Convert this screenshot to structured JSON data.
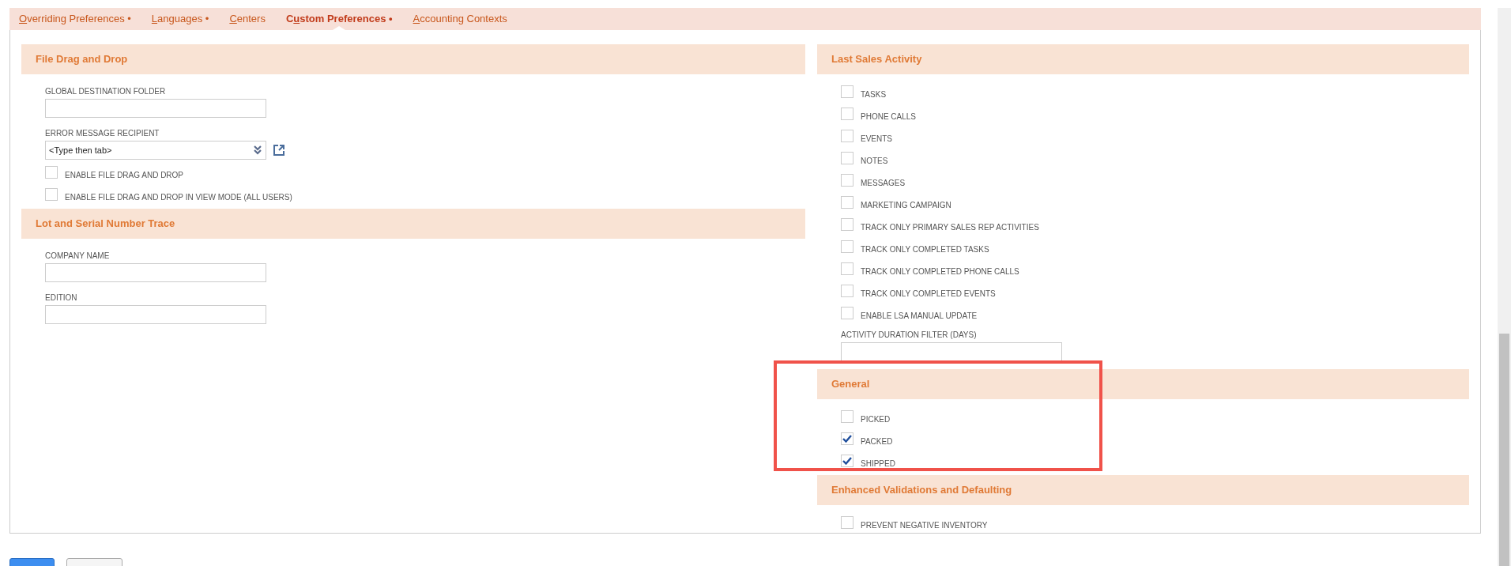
{
  "tabs": [
    {
      "key": "O",
      "rest": "verriding Preferences",
      "marker": "•",
      "selected": false
    },
    {
      "key": "L",
      "rest": "anguages",
      "marker": "•",
      "selected": false
    },
    {
      "key": "C",
      "rest": "enters",
      "selected": false
    },
    {
      "pre": "C",
      "key": "u",
      "rest": "stom Preferences",
      "marker": "•",
      "selected": true
    },
    {
      "key": "A",
      "rest": "ccounting Contexts",
      "selected": false
    }
  ],
  "columns": [
    {
      "sections": [
        {
          "title": "File Drag and Drop",
          "fields": [
            {
              "kind": "text",
              "label": "GLOBAL DESTINATION FOLDER"
            },
            {
              "kind": "select",
              "label": "ERROR MESSAGE RECIPIENT",
              "value": "<Type then tab>"
            },
            {
              "kind": "checkbox",
              "label": "ENABLE FILE DRAG AND DROP",
              "checked": false
            },
            {
              "kind": "checkbox",
              "label": "ENABLE FILE DRAG AND DROP IN VIEW MODE (ALL USERS)",
              "checked": false
            }
          ]
        },
        {
          "title": "Lot and Serial Number Trace",
          "fields": [
            {
              "kind": "text",
              "label": "COMPANY NAME"
            },
            {
              "kind": "text",
              "label": "EDITION"
            }
          ]
        }
      ]
    },
    {
      "sections": [
        {
          "title": "Last Sales Activity",
          "fields": [
            {
              "kind": "checkbox",
              "label": "TASKS",
              "checked": false
            },
            {
              "kind": "checkbox",
              "label": "PHONE CALLS",
              "checked": false
            },
            {
              "kind": "checkbox",
              "label": "EVENTS",
              "checked": false
            },
            {
              "kind": "checkbox",
              "label": "NOTES",
              "checked": false
            },
            {
              "kind": "checkbox",
              "label": "MESSAGES",
              "checked": false
            },
            {
              "kind": "checkbox",
              "label": "MARKETING CAMPAIGN",
              "checked": false
            },
            {
              "kind": "checkbox",
              "label": "TRACK ONLY PRIMARY SALES REP ACTIVITIES",
              "checked": false
            },
            {
              "kind": "checkbox",
              "label": "TRACK ONLY COMPLETED TASKS",
              "checked": false
            },
            {
              "kind": "checkbox",
              "label": "TRACK ONLY COMPLETED PHONE CALLS",
              "checked": false
            },
            {
              "kind": "checkbox",
              "label": "TRACK ONLY COMPLETED EVENTS",
              "checked": false
            },
            {
              "kind": "checkbox",
              "label": "ENABLE LSA MANUAL UPDATE",
              "checked": false
            },
            {
              "kind": "text",
              "label": "ACTIVITY DURATION FILTER (DAYS)"
            }
          ]
        },
        {
          "title": "General",
          "highlighted": true,
          "fields": [
            {
              "kind": "checkbox",
              "label": "PICKED",
              "checked": false
            },
            {
              "kind": "checkbox",
              "label": "PACKED",
              "checked": true
            },
            {
              "kind": "checkbox",
              "label": "SHIPPED",
              "checked": true
            }
          ]
        },
        {
          "title": "Enhanced Validations and Defaulting",
          "fields": [
            {
              "kind": "checkbox",
              "label": "PREVENT NEGATIVE INVENTORY",
              "checked": false
            }
          ]
        }
      ]
    }
  ],
  "buttons": [
    {
      "kind": "primary"
    },
    {
      "kind": "secondary"
    }
  ]
}
